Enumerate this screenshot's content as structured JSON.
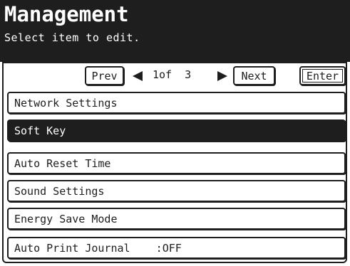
{
  "header": {
    "title": "Management",
    "subtitle": "Select item to edit."
  },
  "nav": {
    "prev_label": "Prev",
    "next_label": "Next",
    "enter_label": "Enter",
    "page_indicator": "1of  3",
    "left_arrow_icon": "left-triangle-icon",
    "right_arrow_icon": "right-triangle-icon"
  },
  "items": [
    {
      "label": "Network Settings",
      "selected": false
    },
    {
      "label": "Soft Key",
      "selected": true
    },
    {
      "label": "Auto Reset Time",
      "selected": false
    },
    {
      "label": "Sound Settings",
      "selected": false
    },
    {
      "label": "Energy Save Mode",
      "selected": false
    },
    {
      "label": "Auto Print Journal    :OFF",
      "selected": false
    }
  ],
  "colors": {
    "dark": "#1e1e1e",
    "light": "#ffffff"
  }
}
